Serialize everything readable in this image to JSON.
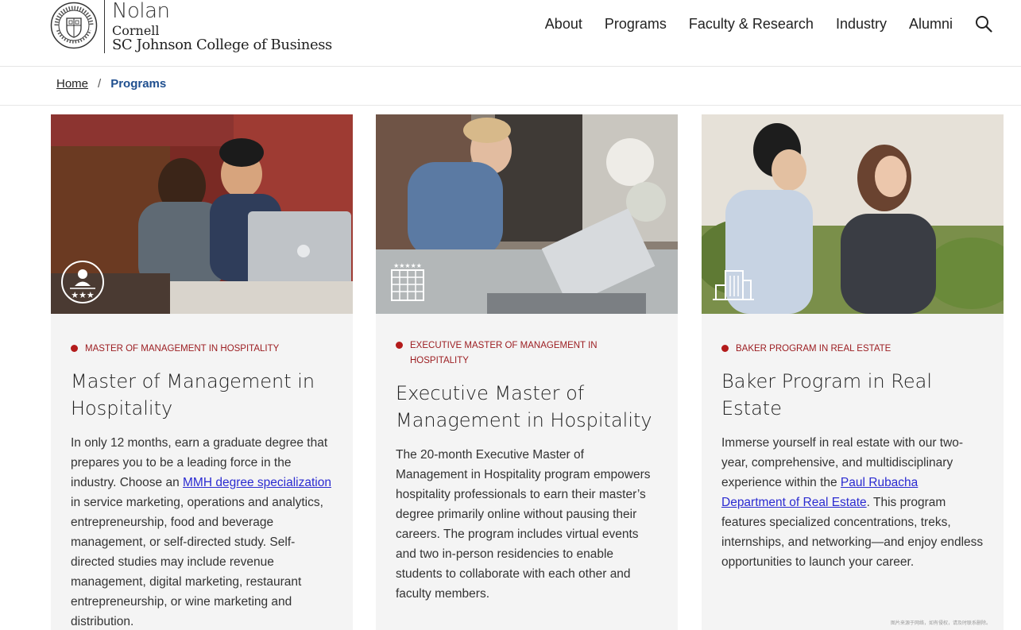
{
  "header": {
    "logo_nolan": "Nolan",
    "logo_cornell": "Cornell",
    "logo_college": "SC Johnson College of Business",
    "nav": [
      "About",
      "Programs",
      "Faculty & Research",
      "Industry",
      "Alumni"
    ]
  },
  "breadcrumb": {
    "home": "Home",
    "separator": "/",
    "current": "Programs"
  },
  "cards": [
    {
      "eyebrow": "Master of Management in Hospitality",
      "title": "Master of Management in Hospitality",
      "desc_before": "In only 12 months, earn a graduate degree that prepares you to be a leading force in the industry. Choose an ",
      "desc_link": "MMH degree specialization",
      "desc_after": " in service marketing, operations and analytics, entrepreneurship, food and beverage management, or self-directed study. Self-directed studies may include revenue management, digital marketing, restaurant entrepreneurship, or wine marketing and distribution.",
      "icon": "hospitality-rating-icon"
    },
    {
      "eyebrow": "Executive Master of Management in Hospitality",
      "title": "Executive Master of Management in Hospitality",
      "desc": "The 20-month Executive Master of Management in Hospitality program empowers hospitality professionals to earn their master’s degree primarily online without pausing their careers. The program includes virtual events and two in-person residencies to enable students to collaborate with each other and faculty members.",
      "icon": "hotel-building-icon"
    },
    {
      "eyebrow": "Baker Program in Real Estate",
      "title": "Baker Program in Real Estate",
      "desc_before": "Immerse yourself in real estate with our two-year, comprehensive, and multidisciplinary experience within the ",
      "desc_link": "Paul Rubacha Department of Real Estate",
      "desc_after": ". This program features specialized concentrations, treks, internships, and networking—and enjoy endless opportunities to launch your career.",
      "icon": "city-buildings-icon"
    }
  ],
  "watermark": "图片来源于网络，如有侵权，请及时联系删除。",
  "colors": {
    "accent": "#b31b1b",
    "link": "#2b2bd1",
    "breadcrumb_current": "#1f4f8f",
    "card_bg": "#f4f4f4"
  }
}
